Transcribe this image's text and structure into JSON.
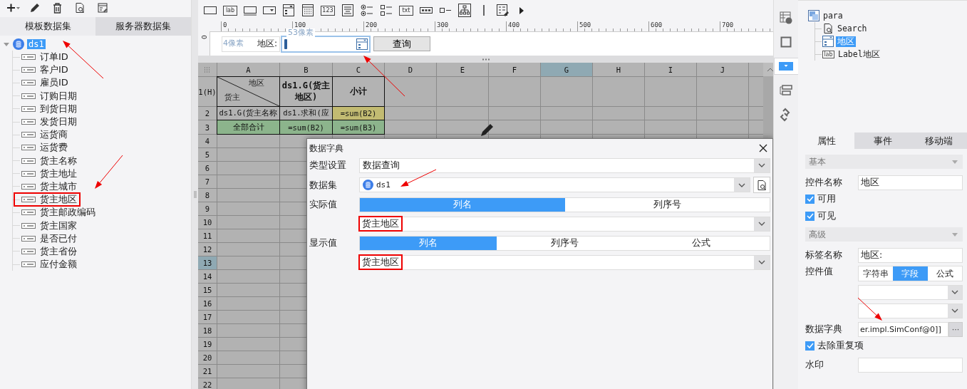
{
  "left_panel": {
    "toolbar": [
      {
        "kind": "add"
      },
      {
        "kind": "edit"
      },
      {
        "kind": "delete"
      },
      {
        "kind": "preview"
      },
      {
        "kind": "edit-sql"
      }
    ],
    "tabs": [
      {
        "label": "模板数据集",
        "selected": true
      },
      {
        "label": "服务器数据集",
        "selected": false
      }
    ],
    "tree": {
      "label": "ds1",
      "expanded": true,
      "selected": true,
      "children": [
        {
          "label": "订单ID",
          "selected": false,
          "highlighted": false
        },
        {
          "label": "客户ID",
          "selected": false,
          "highlighted": false
        },
        {
          "label": "雇员ID",
          "selected": false,
          "highlighted": false
        },
        {
          "label": "订购日期",
          "selected": false,
          "highlighted": false
        },
        {
          "label": "到货日期",
          "selected": false,
          "highlighted": false
        },
        {
          "label": "发货日期",
          "selected": false,
          "highlighted": false
        },
        {
          "label": "运货商",
          "selected": false,
          "highlighted": false
        },
        {
          "label": "运货费",
          "selected": false,
          "highlighted": false
        },
        {
          "label": "货主名称",
          "selected": false,
          "highlighted": false
        },
        {
          "label": "货主地址",
          "selected": false,
          "highlighted": false
        },
        {
          "label": "货主城市",
          "selected": false,
          "highlighted": false
        },
        {
          "label": "货主地区",
          "selected": false,
          "highlighted": true
        },
        {
          "label": "货主邮政编码",
          "selected": false,
          "highlighted": false
        },
        {
          "label": "货主国家",
          "selected": false,
          "highlighted": false
        },
        {
          "label": "是否已付",
          "selected": false,
          "highlighted": false
        },
        {
          "label": "货主省份",
          "selected": false,
          "highlighted": false
        },
        {
          "label": "应付金额",
          "selected": false,
          "highlighted": false
        }
      ]
    }
  },
  "designer": {
    "toolbar": [
      {
        "kind": "button"
      },
      {
        "kind": "label",
        "text": "lab"
      },
      {
        "kind": "textbox"
      },
      {
        "kind": "combo"
      },
      {
        "kind": "combo-list"
      },
      {
        "kind": "date"
      },
      {
        "kind": "number",
        "text": "123"
      },
      {
        "kind": "textarea"
      },
      {
        "kind": "radio-group"
      },
      {
        "kind": "checkbox-group"
      },
      {
        "kind": "text",
        "text": "txt"
      },
      {
        "kind": "password"
      },
      {
        "kind": "checkbox"
      },
      {
        "kind": "tree"
      },
      {
        "kind": "separator"
      },
      {
        "kind": "form-edit"
      },
      {
        "kind": "more"
      }
    ],
    "ruler": [
      "0",
      "100",
      "200",
      "300",
      "400",
      "500",
      "600",
      "700"
    ],
    "vertical_ruler": "0",
    "parameter_form": {
      "label_hint": "4像素",
      "label": "地区:",
      "input_hint": "53像素",
      "button": "查询"
    },
    "grid": {
      "columns": [
        {
          "label": "A",
          "selected": false
        },
        {
          "label": "B",
          "selected": false
        },
        {
          "label": "C",
          "selected": false
        },
        {
          "label": "D",
          "selected": false
        },
        {
          "label": "E",
          "selected": false
        },
        {
          "label": "F",
          "selected": false
        },
        {
          "label": "G",
          "selected": true
        },
        {
          "label": "H",
          "selected": false
        },
        {
          "label": "I",
          "selected": false
        },
        {
          "label": "J",
          "selected": false
        }
      ],
      "rows": [
        {
          "label": "1(H)",
          "selected": false,
          "cells": [
            {
              "kind": "diagonal",
              "top": "地区",
              "bottom": "货主",
              "color": "#b3b3b3"
            },
            {
              "kind": "header",
              "text": "ds1.G(货主地区)",
              "color": "#b3b3b3"
            },
            {
              "kind": "header",
              "text": "小计",
              "color": "#b3b3b3"
            }
          ]
        },
        {
          "label": "2",
          "selected": false,
          "cells": [
            {
              "kind": "plain",
              "text": "ds1.G(货主名称",
              "color": "#b3b3b3"
            },
            {
              "kind": "plain",
              "text": "ds1.求和(应",
              "color": "#b3b3b3"
            },
            {
              "kind": "plain",
              "text": "=sum(B2)",
              "color": "#c2bb72"
            }
          ]
        },
        {
          "label": "3",
          "selected": false,
          "cells": [
            {
              "kind": "plain",
              "text": "全部合计",
              "color": "#8cb48c"
            },
            {
              "kind": "plain",
              "text": "=sum(B2)",
              "color": "#8cb48c"
            },
            {
              "kind": "plain",
              "text": "=sum(B3)",
              "color": "#8cb48c"
            }
          ]
        },
        {
          "label": "4",
          "selected": false
        },
        {
          "label": "5",
          "selected": false
        },
        {
          "label": "6",
          "selected": false
        },
        {
          "label": "7",
          "selected": false
        },
        {
          "label": "8",
          "selected": false
        },
        {
          "label": "9",
          "selected": false
        },
        {
          "label": "10",
          "selected": false
        },
        {
          "label": "11",
          "selected": false
        },
        {
          "label": "12",
          "selected": false
        },
        {
          "label": "13",
          "selected": true
        },
        {
          "label": "14",
          "selected": false
        },
        {
          "label": "15",
          "selected": false
        },
        {
          "label": "16",
          "selected": false
        },
        {
          "label": "17",
          "selected": false
        },
        {
          "label": "18",
          "selected": false
        },
        {
          "label": "19",
          "selected": false
        },
        {
          "label": "20",
          "selected": false
        },
        {
          "label": "21",
          "selected": false
        },
        {
          "label": "22",
          "selected": false
        }
      ]
    }
  },
  "dialog": {
    "title": "数据字典",
    "rows": [
      {
        "kind": "dropdown",
        "label": "类型设置",
        "value": "数据查询",
        "highlighted": false
      },
      {
        "kind": "dataset",
        "label": "数据集",
        "value": "ds1"
      },
      {
        "kind": "segmented",
        "label": "实际值",
        "options": [
          {
            "label": "列名",
            "selected": true
          },
          {
            "label": "列序号",
            "selected": false
          }
        ]
      },
      {
        "kind": "dropdown",
        "value": "货主地区",
        "highlighted": true
      },
      {
        "kind": "segmented",
        "label": "显示值",
        "options": [
          {
            "label": "列名",
            "selected": true
          },
          {
            "label": "列序号",
            "selected": false
          },
          {
            "label": "公式",
            "selected": false
          }
        ]
      },
      {
        "kind": "dropdown",
        "value": "货主地区",
        "highlighted": true
      }
    ]
  },
  "side_toolbar": [
    {
      "kind": "cell-info",
      "selected": false
    },
    {
      "kind": "frame",
      "selected": false
    },
    {
      "kind": "combo",
      "selected": true
    },
    {
      "kind": "layout",
      "selected": false
    },
    {
      "kind": "link",
      "selected": false
    }
  ],
  "widget_tree": {
    "label": "para",
    "children": [
      {
        "kind": "search",
        "label": "Search",
        "selected": false
      },
      {
        "kind": "combo",
        "label": "地区",
        "selected": true
      },
      {
        "kind": "label",
        "icon_text": "lab",
        "label": "Label地区",
        "selected": false
      }
    ]
  },
  "properties": {
    "tabs": [
      {
        "label": "属性",
        "selected": true
      },
      {
        "label": "事件",
        "selected": false
      },
      {
        "label": "移动端",
        "selected": false
      }
    ],
    "sections": [
      {
        "title": "基本",
        "expanded": true,
        "fields": [
          {
            "kind": "text",
            "label": "控件名称",
            "value": "地区"
          },
          {
            "kind": "checkbox",
            "label": "可用",
            "checked": true
          },
          {
            "kind": "checkbox",
            "label": "可见",
            "checked": true
          }
        ]
      },
      {
        "title": "高级",
        "expanded": true,
        "fields": [
          {
            "kind": "text",
            "label": "标签名称",
            "value": "地区:"
          },
          {
            "kind": "segmented",
            "label": "控件值",
            "options": [
              {
                "label": "字符串",
                "selected": false
              },
              {
                "label": "字段",
                "selected": true
              },
              {
                "label": "公式",
                "selected": false
              }
            ]
          },
          {
            "kind": "dropdown"
          },
          {
            "kind": "dropdown"
          },
          {
            "kind": "button-field",
            "label": "数据字典",
            "value": "er.impl.SimConf@0]]",
            "button": "···"
          },
          {
            "kind": "checkbox",
            "label": "去除重复项",
            "checked": true
          },
          {
            "kind": "text",
            "label": "水印"
          }
        ]
      }
    ]
  }
}
